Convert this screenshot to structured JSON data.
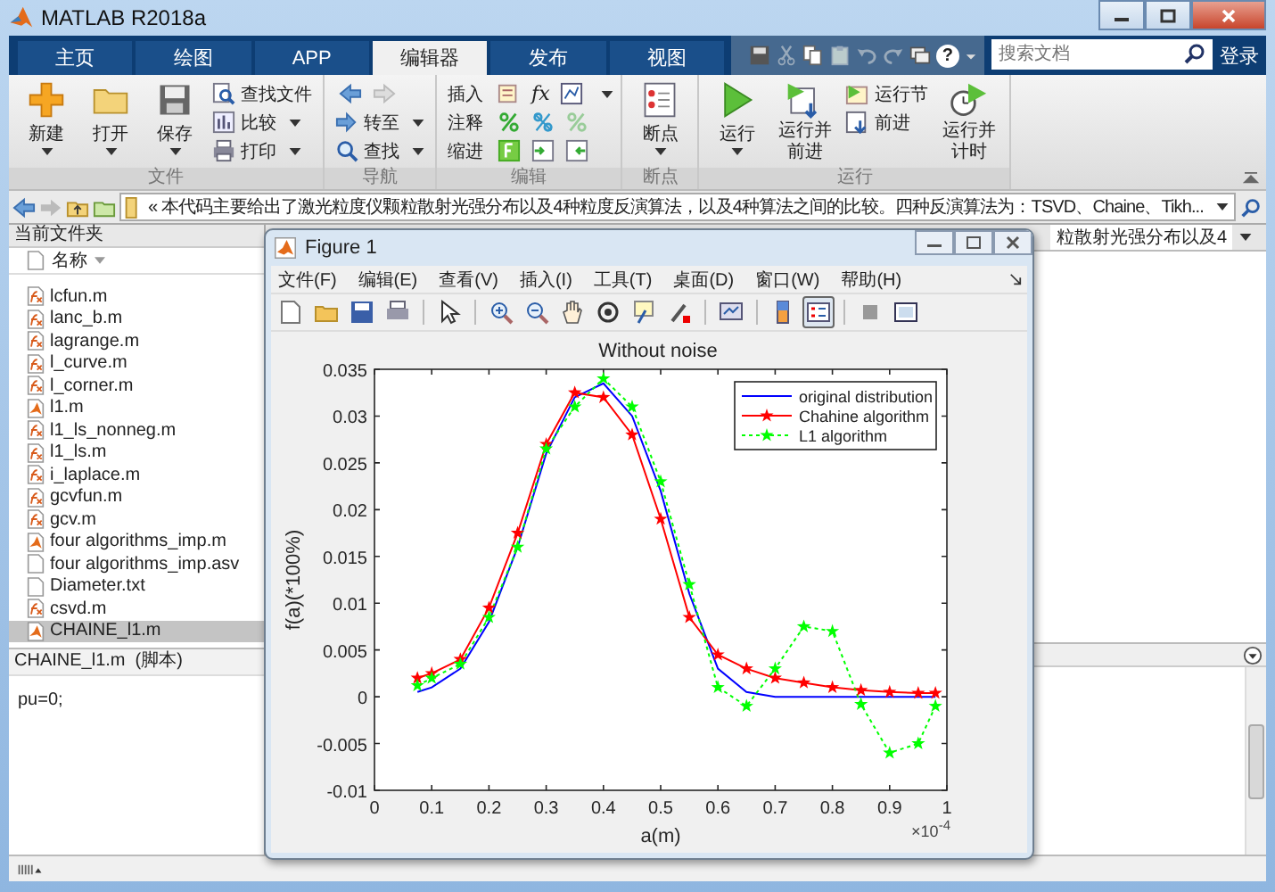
{
  "window": {
    "title": "MATLAB R2018a"
  },
  "tabs": [
    {
      "label": "主页",
      "selected": false
    },
    {
      "label": "绘图",
      "selected": false
    },
    {
      "label": "APP",
      "selected": false
    },
    {
      "label": "编辑器",
      "selected": true
    },
    {
      "label": "发布",
      "selected": false
    },
    {
      "label": "视图",
      "selected": false
    }
  ],
  "quick_access": {
    "help_symbol": "?"
  },
  "search": {
    "placeholder": "搜索文档"
  },
  "login": "登录",
  "ribbon": {
    "file": {
      "label": "文件",
      "new": "新建",
      "open": "打开",
      "save": "保存",
      "find_files": "查找文件",
      "compare": "比较",
      "print": "打印"
    },
    "navigate": {
      "label": "导航",
      "go_to": "转至",
      "find": "查找"
    },
    "edit": {
      "label": "编辑",
      "insert": "插入",
      "comment": "注释",
      "indent": "缩进",
      "fx": "fx"
    },
    "breakpoints": {
      "label": "断点",
      "breakpoints": "断点"
    },
    "run": {
      "label": "运行",
      "run": "运行",
      "run_advance": "运行并前进",
      "run_section": "运行节",
      "advance": "前进",
      "run_time": "运行并计时"
    }
  },
  "address_bar": {
    "chevron": "«",
    "text": "本代码主要给出了激光粒度仪颗粒散射光强分布以及4种粒度反演算法，以及4种算法之间的比较。四种反演算法为：TSVD、Chaine、Tikh..."
  },
  "current_folder": {
    "title": "当前文件夹",
    "column": "名称",
    "files": [
      {
        "name": "lcfun.m",
        "kind": "function",
        "selected": false
      },
      {
        "name": "lanc_b.m",
        "kind": "function",
        "selected": false
      },
      {
        "name": "lagrange.m",
        "kind": "function",
        "selected": false
      },
      {
        "name": "l_curve.m",
        "kind": "function",
        "selected": false
      },
      {
        "name": "l_corner.m",
        "kind": "function",
        "selected": false
      },
      {
        "name": "l1.m",
        "kind": "script",
        "selected": false
      },
      {
        "name": "l1_ls_nonneg.m",
        "kind": "function",
        "selected": false
      },
      {
        "name": "l1_ls.m",
        "kind": "function",
        "selected": false
      },
      {
        "name": "i_laplace.m",
        "kind": "function",
        "selected": false
      },
      {
        "name": "gcvfun.m",
        "kind": "function",
        "selected": false
      },
      {
        "name": "gcv.m",
        "kind": "function",
        "selected": false
      },
      {
        "name": "four algorithms_imp.m",
        "kind": "script",
        "selected": false
      },
      {
        "name": "four algorithms_imp.asv",
        "kind": "file",
        "selected": false
      },
      {
        "name": "Diameter.txt",
        "kind": "file",
        "selected": false
      },
      {
        "name": "csvd.m",
        "kind": "function",
        "selected": false
      },
      {
        "name": "CHAINE_l1.m",
        "kind": "script",
        "selected": true
      }
    ]
  },
  "details": {
    "title": "CHAINE_l1.m  (脚本)",
    "code": "pu=0;"
  },
  "editor_tab": "粒散射光强分布以及4",
  "figure": {
    "title": "Figure 1",
    "menu": [
      "文件(F)",
      "编辑(E)",
      "查看(V)",
      "插入(I)",
      "工具(T)",
      "桌面(D)",
      "窗口(W)",
      "帮助(H)"
    ],
    "toolbar": [
      {
        "kind": "new",
        "selected": false
      },
      {
        "kind": "open",
        "selected": false
      },
      {
        "kind": "save",
        "selected": false
      },
      {
        "kind": "print",
        "selected": false
      },
      {
        "kind": "pointer",
        "selected": false
      },
      {
        "kind": "zoom_in",
        "selected": false
      },
      {
        "kind": "zoom_out",
        "selected": false
      },
      {
        "kind": "pan",
        "selected": false
      },
      {
        "kind": "rotate",
        "selected": false
      },
      {
        "kind": "data_cursor",
        "selected": false
      },
      {
        "kind": "brush",
        "selected": false
      },
      {
        "kind": "link",
        "selected": false
      },
      {
        "kind": "colorbar",
        "selected": false
      },
      {
        "kind": "legend",
        "selected": true
      },
      {
        "kind": "grid",
        "selected": false
      },
      {
        "kind": "panel",
        "selected": false
      }
    ],
    "chart_data": {
      "type": "line",
      "title": "Without noise",
      "xlabel": "a(m)",
      "ylabel": "f(a)(*100%)",
      "annotations": [
        {
          "text": "×10$^{-4}$"
        }
      ],
      "legend": true,
      "x": [
        0.075,
        0.1,
        0.15,
        0.2,
        0.25,
        0.3,
        0.35,
        0.4,
        0.45,
        0.5,
        0.55,
        0.6,
        0.65,
        0.7,
        0.75,
        0.8,
        0.85,
        0.9,
        0.95,
        0.98
      ],
      "series": [
        {
          "name": "original distribution",
          "color": "#0000ff",
          "line_style": "solid",
          "marker": "none",
          "values": [
            0.0005,
            0.001,
            0.003,
            0.008,
            0.016,
            0.026,
            0.032,
            0.0335,
            0.03,
            0.022,
            0.011,
            0.003,
            0.0005,
            0,
            0,
            0,
            0,
            0,
            0,
            0
          ]
        },
        {
          "name": "Chahine algorithm",
          "color": "#ff0000",
          "line_style": "solid",
          "marker": "star",
          "values": [
            0.002,
            0.0025,
            0.004,
            0.0095,
            0.0175,
            0.027,
            0.0325,
            0.032,
            0.028,
            0.019,
            0.0085,
            0.0045,
            0.003,
            0.002,
            0.0015,
            0.001,
            0.0007,
            0.0005,
            0.0004,
            0.0004
          ]
        },
        {
          "name": "L1 algorithm",
          "color": "#00ff00",
          "line_style": "dotted",
          "marker": "star",
          "values": [
            0.0012,
            0.002,
            0.0035,
            0.0085,
            0.016,
            0.0265,
            0.031,
            0.034,
            0.031,
            0.023,
            0.012,
            0.001,
            -0.001,
            0.003,
            0.0075,
            0.007,
            -0.0008,
            -0.006,
            -0.005,
            -0.001
          ]
        }
      ],
      "xlim": [
        0,
        1
      ],
      "ylim": [
        -0.01,
        0.035
      ],
      "xticks": [
        0,
        0.1,
        0.2,
        0.3,
        0.4,
        0.5,
        0.6,
        0.7,
        0.8,
        0.9,
        1
      ],
      "yticks": [
        -0.01,
        -0.005,
        0,
        0.005,
        0.01,
        0.015,
        0.02,
        0.025,
        0.03,
        0.035
      ]
    }
  }
}
